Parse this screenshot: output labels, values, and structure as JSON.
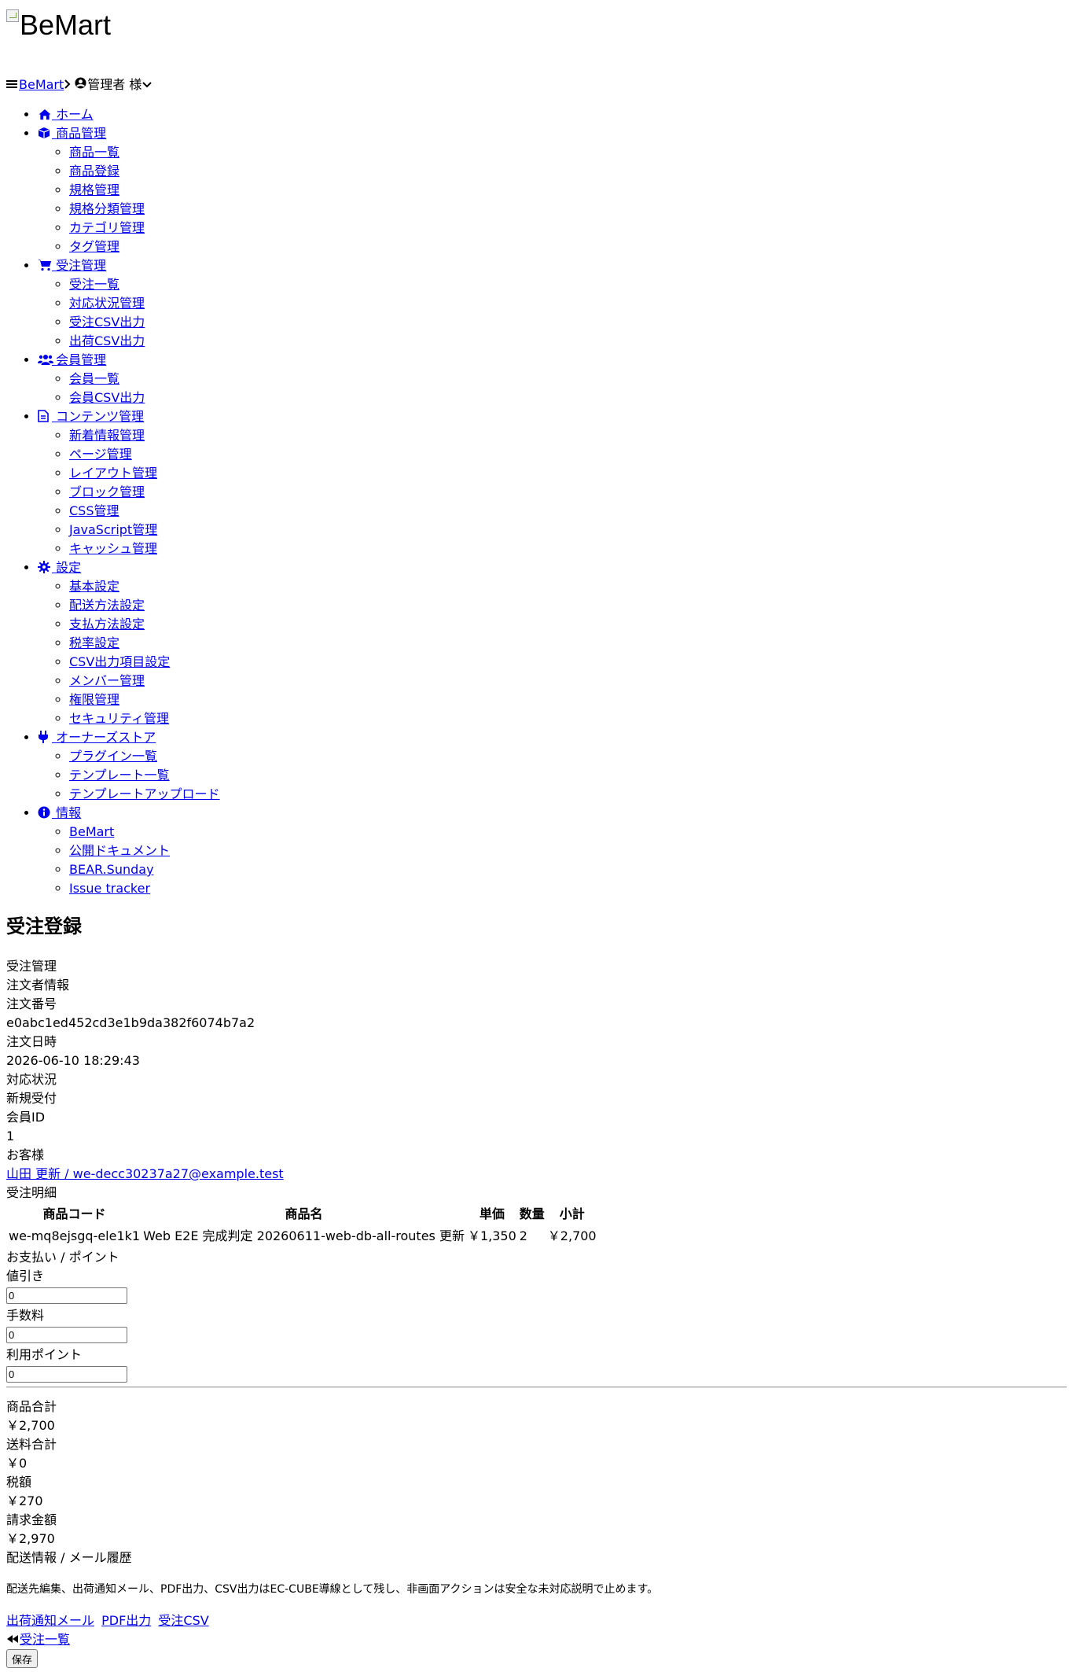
{
  "logo": {
    "alt": "BeMart"
  },
  "topbar": {
    "brand": "BeMart",
    "user": "管理者 様"
  },
  "nav": [
    {
      "label": "ホーム",
      "icon": "home-icon",
      "children": []
    },
    {
      "label": "商品管理",
      "icon": "box-icon",
      "children": [
        "商品一覧",
        "商品登録",
        "規格管理",
        "規格分類管理",
        "カテゴリ管理",
        "タグ管理"
      ]
    },
    {
      "label": "受注管理",
      "icon": "cart-icon",
      "children": [
        "受注一覧",
        "対応状況管理",
        "受注CSV出力",
        "出荷CSV出力"
      ]
    },
    {
      "label": "会員管理",
      "icon": "users-icon",
      "children": [
        "会員一覧",
        "会員CSV出力"
      ]
    },
    {
      "label": "コンテンツ管理",
      "icon": "file-icon",
      "children": [
        "新着情報管理",
        "ページ管理",
        "レイアウト管理",
        "ブロック管理",
        "CSS管理",
        "JavaScript管理",
        "キャッシュ管理"
      ]
    },
    {
      "label": "設定",
      "icon": "gear-icon",
      "children": [
        "基本設定",
        "配送方法設定",
        "支払方法設定",
        "税率設定",
        "CSV出力項目設定",
        "メンバー管理",
        "権限管理",
        "セキュリティ管理"
      ]
    },
    {
      "label": "オーナーズストア",
      "icon": "plug-icon",
      "children": [
        "プラグイン一覧",
        "テンプレート一覧",
        "テンプレートアップロード"
      ]
    },
    {
      "label": "情報",
      "icon": "info-icon",
      "children": [
        "BeMart",
        "公開ドキュメント",
        "BEAR.Sunday",
        "Issue tracker"
      ]
    }
  ],
  "page": {
    "title": "受注登録",
    "section_order": "受注管理",
    "section_customer": "注文者情報",
    "order_no_label": "注文番号",
    "order_no": "e0abc1ed452cd3e1b9da382f6074b7a2",
    "order_date_label": "注文日時",
    "order_date": "2026-06-10 18:29:43",
    "status_label": "対応状況",
    "status": "新規受付",
    "member_id_label": "会員ID",
    "member_id": "1",
    "customer_label": "お客様",
    "customer": "山田 更新 / we-decc30237a27@example.test",
    "details_label": "受注明細"
  },
  "lines": {
    "headers": [
      "商品コード",
      "商品名",
      "単価",
      "数量",
      "小計"
    ],
    "rows": [
      [
        "we-mq8ejsgq-ele1k1",
        "Web E2E 完成判定 20260611-web-db-all-routes 更新",
        "￥1,350",
        "2",
        "￥2,700"
      ]
    ]
  },
  "payment": {
    "section_label": "お支払い / ポイント",
    "discount_label": "値引き",
    "discount": "0",
    "fee_label": "手数料",
    "fee": "0",
    "points_label": "利用ポイント",
    "points": "0"
  },
  "totals": {
    "subtotal_label": "商品合計",
    "subtotal": "￥2,700",
    "shipping_label": "送料合計",
    "shipping": "￥0",
    "tax_label": "税額",
    "tax": "￥270",
    "total_label": "請求金額",
    "total": "￥2,970"
  },
  "shipping_section": {
    "label": "配送情報 / メール履歴",
    "note": "配送先編集、出荷通知メール、PDF出力、CSV出力はEC-CUBE導線として残し、非画面アクションは安全な未対応説明で止めます。",
    "links": [
      "出荷通知メール",
      "PDF出力",
      "受注CSV"
    ]
  },
  "footer": {
    "back_label": "受注一覧",
    "save_label": "保存"
  }
}
